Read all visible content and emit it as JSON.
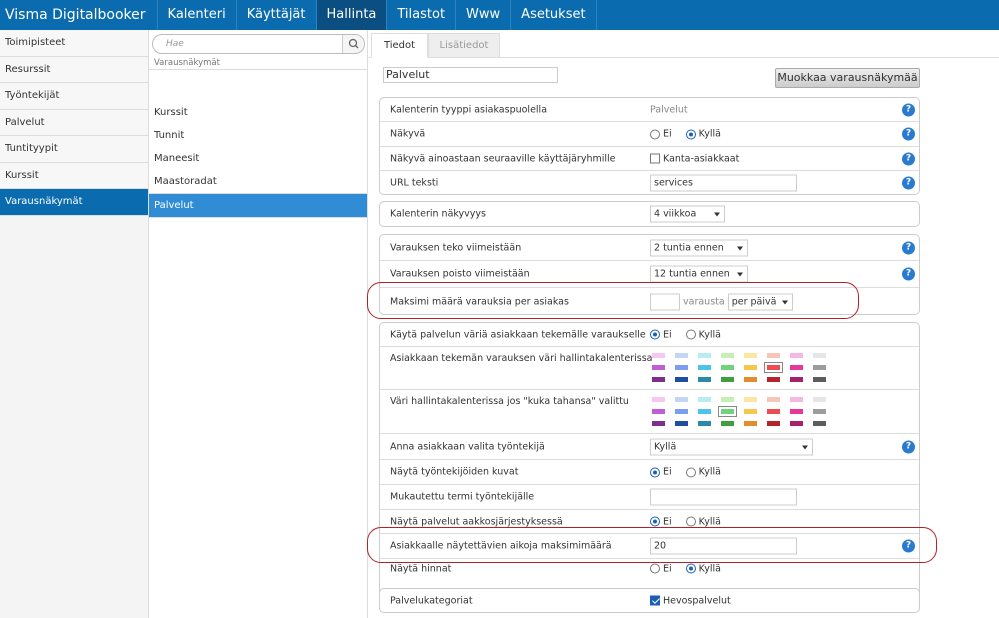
{
  "topbar": {
    "brand": "Visma Digitalbooker",
    "nav": [
      {
        "label": "Kalenteri",
        "active": false
      },
      {
        "label": "Käyttäjät",
        "active": false
      },
      {
        "label": "Hallinta",
        "active": true
      },
      {
        "label": "Tilastot",
        "active": false
      },
      {
        "label": "Www",
        "active": false
      },
      {
        "label": "Asetukset",
        "active": false
      }
    ]
  },
  "leftnav": {
    "items": [
      {
        "label": "Toimipisteet",
        "active": false
      },
      {
        "label": "Resurssit",
        "active": false
      },
      {
        "label": "Työntekijät",
        "active": false
      },
      {
        "label": "Palvelut",
        "active": false
      },
      {
        "label": "Tuntityypit",
        "active": false
      },
      {
        "label": "Kurssit",
        "active": false
      },
      {
        "label": "Varausnäkymät",
        "active": true
      }
    ]
  },
  "midcol": {
    "search_placeholder": "Hae",
    "heading": "Varausnäkymät",
    "items": [
      {
        "label": "Kurssit",
        "active": false
      },
      {
        "label": "Tunnit",
        "active": false
      },
      {
        "label": "Maneesit",
        "active": false
      },
      {
        "label": "Maastoradat",
        "active": false
      },
      {
        "label": "Palvelut",
        "active": true
      }
    ]
  },
  "main": {
    "tabs": [
      {
        "label": "Tiedot"
      },
      {
        "label": "Lisätiedot"
      }
    ],
    "title_value": "Palvelut",
    "edit_button": "Muokkaa varausnäkymää",
    "card1": {
      "calendar_type_label": "Kalenterin tyyppi asiakaspuolella",
      "calendar_type_value": "Palvelut",
      "visible_label": "Näkyvä",
      "visible_no": "Ei",
      "visible_yes": "Kyllä",
      "groups_label": "Näkyvä ainoastaan seuraaville käyttäjäryhmille",
      "groups_option": "Kanta-asiakkaat",
      "url_label": "URL teksti",
      "url_value": "services"
    },
    "card2": {
      "visibility_label": "Kalenterin näkyvyys",
      "visibility_value": "4 viikkoa"
    },
    "card3": {
      "latest_booking_label": "Varauksen teko viimeistään",
      "latest_booking_value": "2 tuntia ennen",
      "latest_cancel_label": "Varauksen poisto viimeistään",
      "latest_cancel_value": "12 tuntia ennen",
      "max_bookings_label": "Maksimi määrä varauksia per asiakas",
      "max_bookings_value": "",
      "max_bookings_unit": "varausta",
      "max_bookings_period": "per päivä"
    },
    "card4": {
      "service_color_label": "Käytä palvelun väriä asiakkaan tekemälle varaukselle",
      "service_color_no": "Ei",
      "service_color_yes": "Kyllä",
      "client_color_label": "Asiakkaan tekemän varauksen väri hallintakalenterissa",
      "any_color_label": "Väri hallintakalenterissa jos \"kuka tahansa\" valittu",
      "colors": [
        "#f7c6f1",
        "#c5d5f5",
        "#b8ecf4",
        "#c6efb4",
        "#fde7a0",
        "#f6c6b8",
        "#f6b7e1",
        "#e6e6e6",
        "#c05ed6",
        "#7c9ef0",
        "#4bc4e8",
        "#6fd37e",
        "#f6c74a",
        "#ee4c51",
        "#e6389b",
        "#9d9d9d",
        "#7e2f8e",
        "#1f4ea1",
        "#2a8aa7",
        "#3f9f3f",
        "#e48d2b",
        "#b6242b",
        "#a5216b",
        "#5d5d5d"
      ],
      "selected_client_color_index": 13,
      "selected_any_color_index": 11,
      "employee_select_label": "Anna asiakkaan valita työntekijä",
      "employee_select_value": "Kyllä",
      "employee_images_label": "Näytä työntekijöiden kuvat",
      "employee_images_no": "Ei",
      "employee_images_yes": "Kyllä",
      "employee_term_label": "Mukautettu termi työntekijälle",
      "employee_term_value": "",
      "alpha_label": "Näytä palvelut aakkosjärjestyksessä",
      "alpha_no": "Ei",
      "alpha_yes": "Kyllä",
      "max_times_label": "Asiakkaalle näytettävien aikoja maksimimäärä",
      "max_times_value": "20",
      "prices_label": "Näytä hinnat",
      "prices_no": "Ei",
      "prices_yes": "Kyllä"
    },
    "card5": {
      "categories_label": "Palvelukategoriat",
      "categories_option": "Hevospalvelut"
    }
  }
}
